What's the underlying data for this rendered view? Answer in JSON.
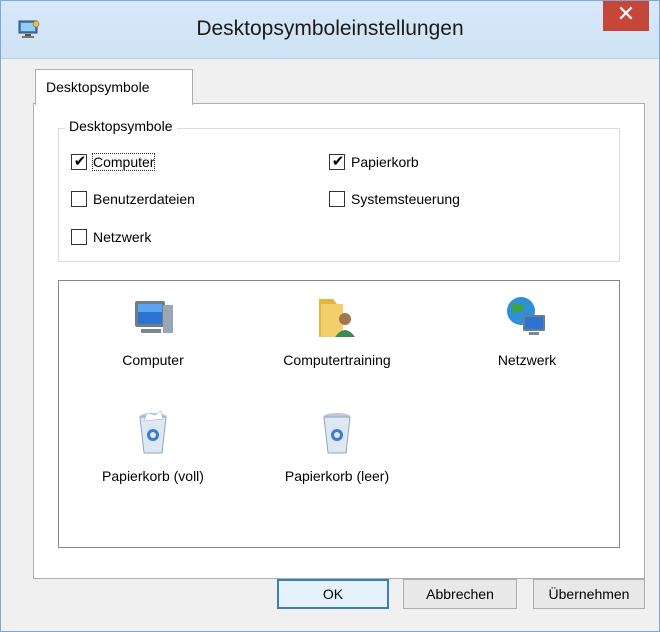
{
  "window": {
    "title": "Desktopsymboleinstellungen",
    "close_glyph": "✕",
    "icon": "desktop-settings-icon"
  },
  "tabs": [
    {
      "label": "Desktopsymbole",
      "selected": true
    }
  ],
  "group": {
    "legend": "Desktopsymbole",
    "checkboxes": [
      {
        "label": "Computer",
        "checked": true
      },
      {
        "label": "Papierkorb",
        "checked": true
      },
      {
        "label": "Benutzerdateien",
        "checked": false
      },
      {
        "label": "Systemsteuerung",
        "checked": false
      },
      {
        "label": "Netzwerk",
        "checked": false
      }
    ],
    "check_glyph": "✔"
  },
  "icons": [
    {
      "label": "Computer",
      "icon": "computer-icon"
    },
    {
      "label": "Computertraining",
      "icon": "user-folder-icon"
    },
    {
      "label": "Netzwerk",
      "icon": "network-icon"
    },
    {
      "label": "Papierkorb (voll)",
      "icon": "recycle-bin-full-icon"
    },
    {
      "label": "Papierkorb (leer)",
      "icon": "recycle-bin-empty-icon"
    }
  ],
  "buttons": {
    "ok": "OK",
    "cancel": "Abbrechen",
    "apply": "Übernehmen"
  },
  "colors": {
    "close_button": "#c7463a",
    "titlebar": "#d6e8f8",
    "window_border": "#7ea9d4"
  }
}
